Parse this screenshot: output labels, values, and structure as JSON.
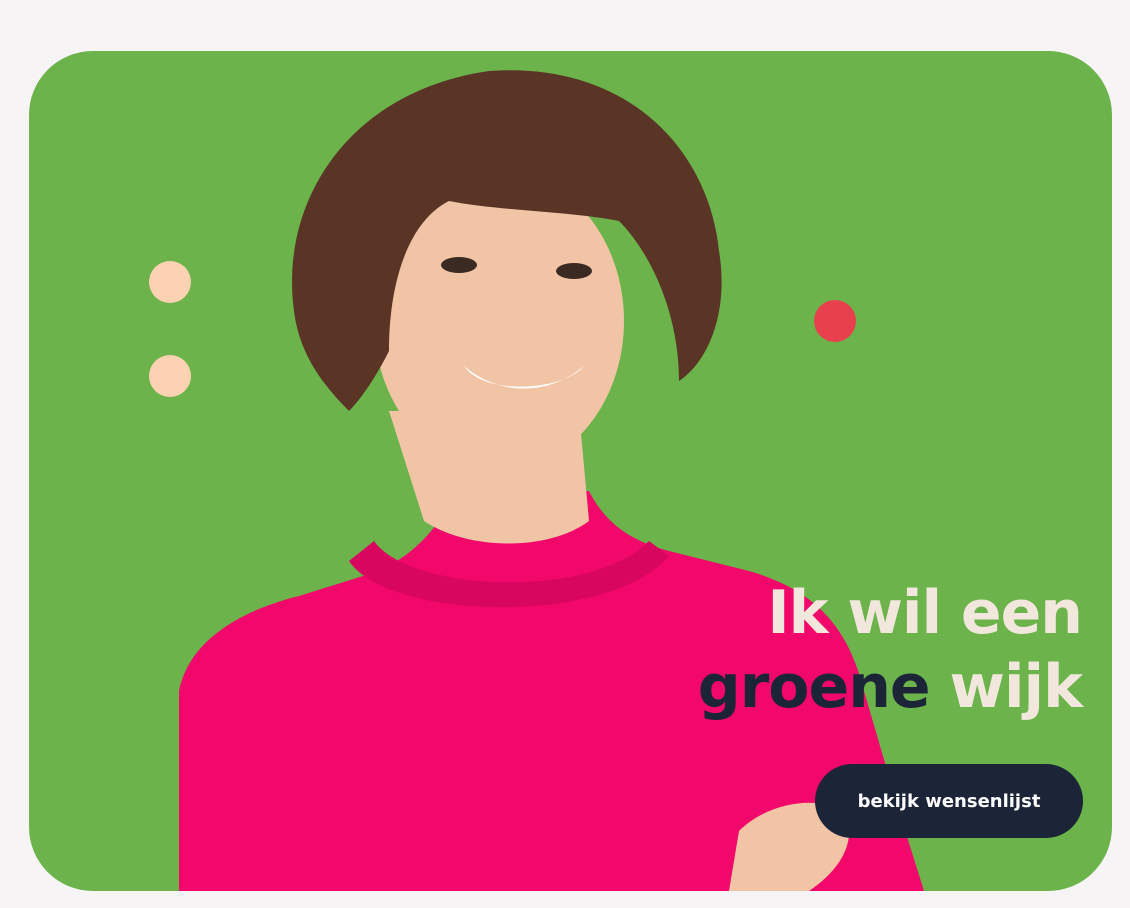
{
  "colors": {
    "page_background": "#f7f4f6",
    "card_green": "#6bb34a",
    "dot_peach": "#fdd2b2",
    "dot_red": "#e8404c",
    "sweater_pink": "#f2086a",
    "hair_brown": "#5a3526",
    "skin": "#f1c4a6",
    "headline_light": "#f1e7dd",
    "headline_dark": "#1c2438",
    "button_bg": "#1c2438",
    "button_text": "#ffffff"
  },
  "hero": {
    "headline_line1": "Ik wil een",
    "headline_line2_emphasis": "groene",
    "headline_line2_rest": " wijk",
    "cta_label": "bekijk wensenlijst",
    "image": "smiling-woman-in-pink-sweater"
  }
}
